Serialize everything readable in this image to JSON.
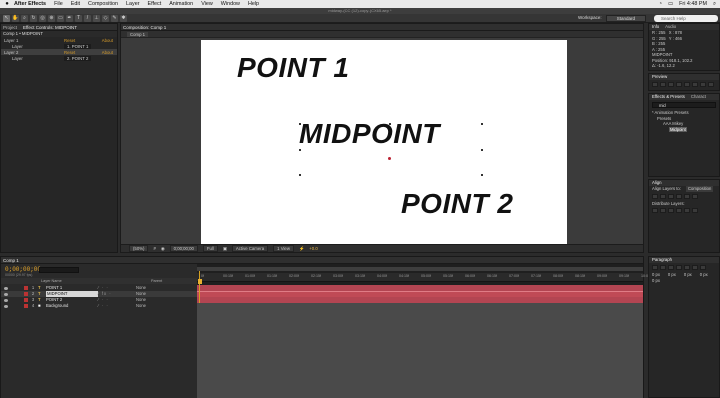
{
  "menubar": {
    "apple": "",
    "app_name": "After Effects",
    "items": [
      "File",
      "Edit",
      "Composition",
      "Layer",
      "Effect",
      "Animation",
      "View",
      "Window",
      "Help"
    ],
    "clock": "Fri 4:48 PM"
  },
  "window_title": "midway-(CC (12)-copy-(CX65.aep *",
  "workspace": {
    "label": "Workspace:",
    "value": "Standard"
  },
  "search_help": {
    "placeholder": "Search Help"
  },
  "effect_controls": {
    "tabs": [
      "Project",
      "Effect Controls: MIDPOINT"
    ],
    "header": "Comp 1 • MIDPOINT",
    "rows": [
      {
        "name": "Layer 1",
        "value": "Reset",
        "about": "About"
      },
      {
        "name": "Layer",
        "value": "1. POINT 1",
        "about": ""
      },
      {
        "name": "Layer 2",
        "value": "Reset",
        "about": "About"
      },
      {
        "name": "Layer",
        "value": "2. POINT 2",
        "about": ""
      }
    ]
  },
  "composition": {
    "tab": "Composition: Comp 1",
    "subtab": "Comp 1",
    "texts": [
      "POINT 1",
      "MIDPOINT",
      "POINT 2"
    ],
    "bottom": {
      "zoom": "(50%)",
      "timecode": "0;00;00;00",
      "resolution": "Full",
      "camera": "Active Camera",
      "views": "1 View",
      "offset": "+0.0"
    }
  },
  "info": {
    "tabs": [
      "Info",
      "Audio"
    ],
    "r": "R : 255",
    "g": "G : 255",
    "b": "B : 255",
    "a": "A : 255",
    "x": "X : 878",
    "y": "Y : 466",
    "layer": "MIDPOINT",
    "position": "Position: 918.1, 102.2",
    "delta": "Δ: -1.6, 12.2"
  },
  "preview": {
    "title": "Preview"
  },
  "effects_presets": {
    "tabs": [
      "Effects & Presets",
      "Charact"
    ],
    "search": "mid",
    "tree": [
      "* Animation Presets",
      "Presets",
      "AAA Mikey",
      "Midpoint"
    ]
  },
  "align": {
    "title": "Align",
    "align_to_label": "Align Layers to:",
    "align_to_value": "Composition",
    "distribute": "Distribute Layers:"
  },
  "paragraph": {
    "title": "Paragraph",
    "values": [
      "0 px",
      "0 px",
      "0 px",
      "0 px",
      "0 px"
    ]
  },
  "timeline": {
    "tab": "Comp 1",
    "timecode": "0;00;00;00",
    "timecode_sub": "00000 (29.97 fps)",
    "columns": {
      "source": "Layer Name",
      "parent": "Parent"
    },
    "layers": [
      {
        "num": "1",
        "type": "T",
        "name": "POINT 1",
        "parent": "None",
        "selected": false
      },
      {
        "num": "2",
        "type": "T",
        "name": "MIDPOINT",
        "parent": "None",
        "selected": true
      },
      {
        "num": "3",
        "type": "T",
        "name": "POINT 2",
        "parent": "None",
        "selected": false
      },
      {
        "num": "4",
        "type": "■",
        "name": "Background",
        "parent": "None",
        "selected": false
      }
    ],
    "ruler": [
      "0f",
      "00:15f",
      "01:00f",
      "01:15f",
      "02:00f",
      "02:15f",
      "03:00f",
      "03:15f",
      "04:00f",
      "04:15f",
      "05:00f",
      "05:15f",
      "06:00f",
      "06:15f",
      "07:00f",
      "07:15f",
      "08:00f",
      "08:15f",
      "09:00f",
      "09:15f",
      "10:0"
    ],
    "colors": {
      "bar": "#b34552",
      "bar_selected": "#c04a56",
      "playhead": "#d4a021"
    }
  }
}
